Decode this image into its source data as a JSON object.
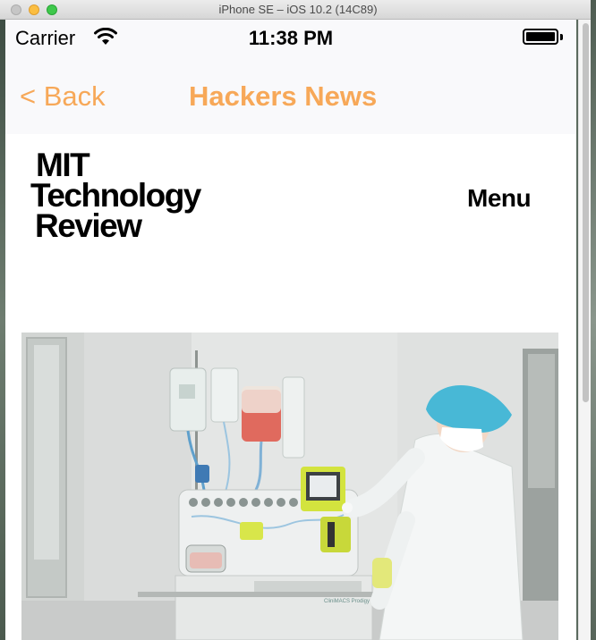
{
  "window": {
    "title": "iPhone SE – iOS 10.2 (14C89)"
  },
  "status_bar": {
    "carrier": "Carrier",
    "time": "11:38 PM"
  },
  "nav_bar": {
    "back_label": "< Back",
    "title": "Hackers News"
  },
  "page": {
    "logo_lines": [
      "MIT",
      "Technology",
      "Review"
    ],
    "menu_label": "Menu",
    "hero_image": "lab technician operating cell processing machine"
  },
  "colors": {
    "accent": "#f7a858",
    "nav_background": "#f9f9fb"
  }
}
